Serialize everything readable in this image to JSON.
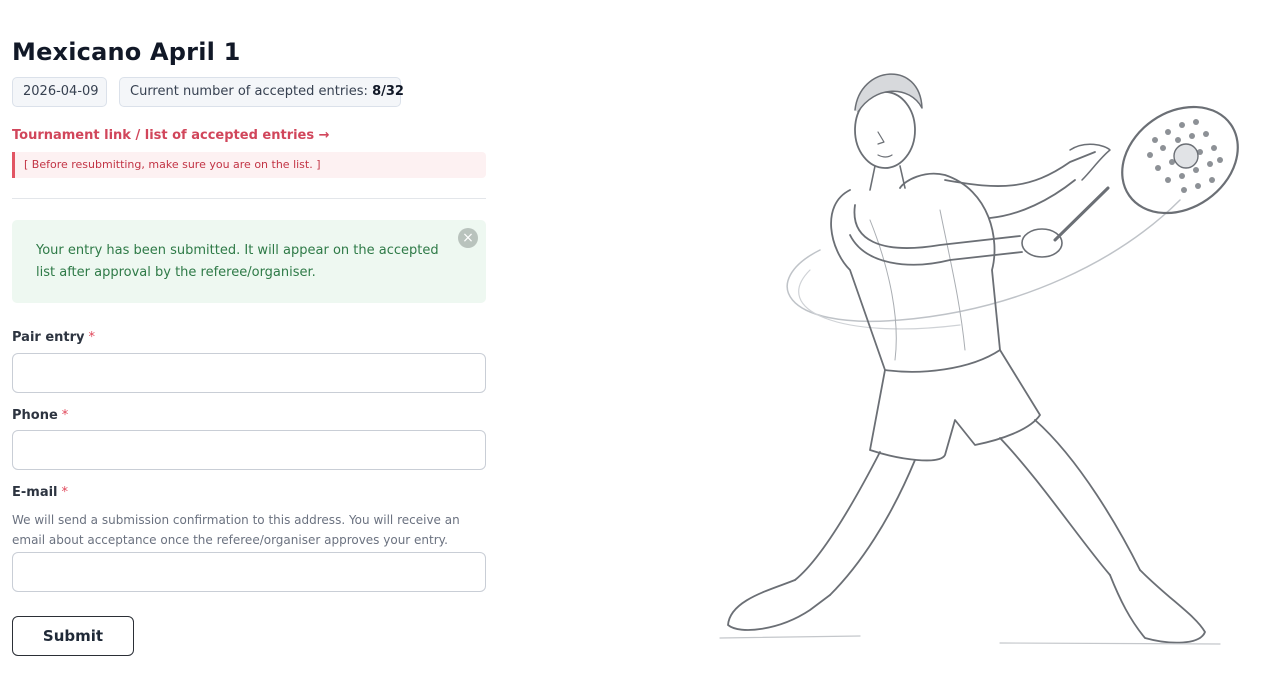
{
  "page": {
    "title": "Mexicano April 1",
    "date": "2026-04-09",
    "entries_label": "Current number of accepted entries:",
    "entries_value": "8/32"
  },
  "tournament_link": "Tournament link / list of accepted entries →",
  "warning": "[ Before resubmitting, make sure you are on the list. ]",
  "alert": {
    "message": "Your entry has been submitted. It will appear on the accepted list after approval by the referee/organiser.",
    "close_icon": "×"
  },
  "form": {
    "pair_label": "Pair entry",
    "pair_value": "",
    "phone_label": "Phone",
    "phone_value": "",
    "email_label": "E-mail",
    "email_hint": "We will send a submission confirmation to this address. You will receive an email about acceptance once the referee/organiser approves your entry.",
    "email_value": "",
    "required_mark": "*",
    "submit_label": "Submit"
  },
  "illustration": {
    "icon": "padel-player-sketch"
  },
  "colors": {
    "accent": "#d1465b",
    "success_bg": "#eef8f1",
    "success_text": "#2e7a47",
    "warning_bg": "#fdf1f2"
  }
}
